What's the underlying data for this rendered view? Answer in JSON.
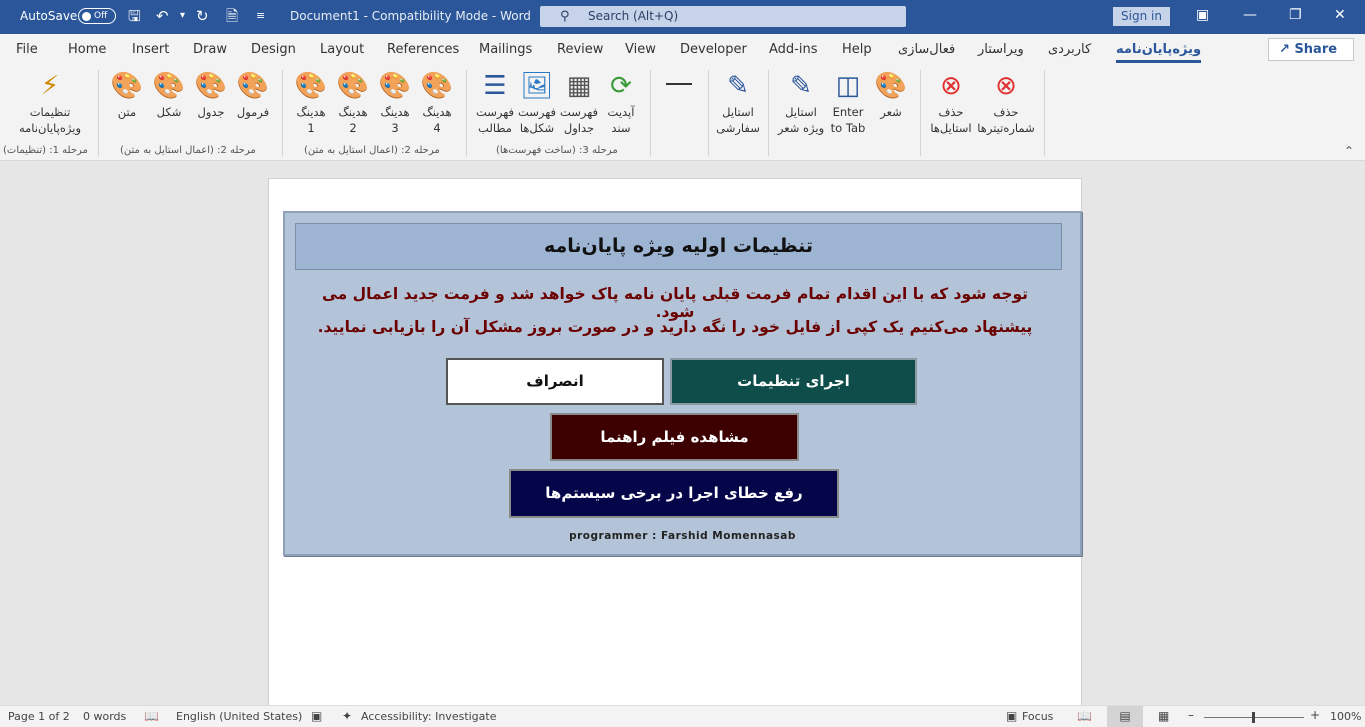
{
  "titlebar": {
    "autosave_label": "AutoSave",
    "autosave_state": "Off",
    "document_title": "Document1  -  Compatibility Mode  -  Word",
    "search_placeholder": "Search (Alt+Q)",
    "sign_in": "Sign in"
  },
  "menu": {
    "tabs": [
      "File",
      "Home",
      "Insert",
      "Draw",
      "Design",
      "Layout",
      "References",
      "Mailings",
      "Review",
      "View",
      "Developer",
      "Add-ins",
      "Help",
      "فعال‌سازی",
      "ویراستار",
      "کاربردی",
      "ویژه‌پایان‌نامه"
    ],
    "active_tab": "ویژه‌پایان‌نامه",
    "share": "Share"
  },
  "ribbon": {
    "buttons": [
      {
        "label1": "تنظیمات",
        "label2": "ویژه‌پایان‌نامه"
      },
      {
        "label1": "متن",
        "label2": ""
      },
      {
        "label1": "شکل",
        "label2": ""
      },
      {
        "label1": "جدول",
        "label2": ""
      },
      {
        "label1": "فرمول",
        "label2": ""
      },
      {
        "label1": "هدینگ",
        "label2": "1"
      },
      {
        "label1": "هدینگ",
        "label2": "2"
      },
      {
        "label1": "هدینگ",
        "label2": "3"
      },
      {
        "label1": "هدینگ",
        "label2": "4"
      },
      {
        "label1": "فهرست",
        "label2": "مطالب"
      },
      {
        "label1": "فهرست",
        "label2": "شکل‌ها"
      },
      {
        "label1": "فهرست",
        "label2": "جداول"
      },
      {
        "label1": "آپدیت",
        "label2": "سند"
      },
      {
        "label1": "استایل",
        "label2": "سفارشی"
      },
      {
        "label1": "استایل",
        "label2": "ویژه شعر"
      },
      {
        "label1": "Enter",
        "label2": "to Tab"
      },
      {
        "label1": "شعر",
        "label2": ""
      },
      {
        "label1": "حذف",
        "label2": "استایل‌ها"
      },
      {
        "label1": "حذف",
        "label2": "شماره‌تیترها"
      }
    ],
    "groups": [
      "مرحله 1: (تنظیمات)",
      "مرحله 2: (اعمال استایل به متن)",
      "مرحله 2: (اعمال استایل به متن)",
      "مرحله 3: (ساخت فهرست‌ها)"
    ]
  },
  "dialog": {
    "title": "تنظیمات اولیه ویژه پایان‌نامه",
    "warning_line1": "توجه شود که با این اقدام تمام فرمت قبلی پایان نامه پاک خواهد شد و فرمت جدید اعمال می شود.",
    "warning_line2": "پیشنهاد می‌کنیم یک کپی از فایل خود را نگه دارید و  در صورت بروز مشکل آن را بازیابی نمایید.",
    "run_button": "اجرای تنظیمات",
    "cancel_button": "انصراف",
    "video_button": "مشاهده فیلم راهنما",
    "fix_button": "رفع خطای اجرا در برخی سیستم‌ها",
    "programmer": "programmer :  Farshid  Momennasab",
    "colors": {
      "run": "#0e4d4a",
      "video": "#3d0000",
      "fix": "#05054a",
      "cancel": "#ffffff"
    }
  },
  "status": {
    "page": "Page 1 of 2",
    "words": "0 words",
    "language": "English (United States)",
    "accessibility": "Accessibility: Investigate",
    "focus": "Focus",
    "zoom": "100%"
  }
}
